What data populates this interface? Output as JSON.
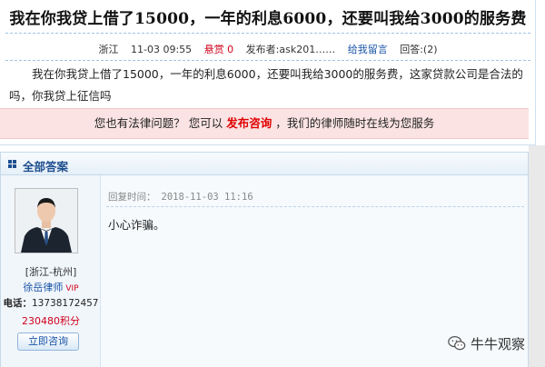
{
  "question": {
    "title": "我在你我贷上借了15000，一年的利息6000，还要叫我给3000的服务费",
    "location": "浙江",
    "time": "11-03 09:55",
    "reward_text": "悬赏 0",
    "publisher": "发布者:ask201……",
    "message_link": "给我留言",
    "answers_count": "回答:(2)",
    "body": "我在你我贷上借了15000，一年的利息6000，还要叫我给3000的服务费，这家贷款公司是合法的吗，你我贷上征信吗"
  },
  "cta": {
    "prefix": "您也有法律问题？ 您可以",
    "link": "发布咨询",
    "suffix": "，我们的律师随时在线为您服务"
  },
  "answers": {
    "section_title": "全部答案",
    "items": [
      {
        "lawyer": {
          "location": "[浙江-杭州]",
          "name": "徐岳律师",
          "vip": "VIP",
          "phone_label": "电话：",
          "phone": "13738172457",
          "points": "230480积分",
          "consult_button": "立即咨询"
        },
        "reply_time_label": "回复时间：",
        "reply_time": "2018-11-03 11:16",
        "reply_body": "小心诈骗。"
      }
    ]
  },
  "watermark": {
    "text": "牛牛观察"
  },
  "colors": {
    "accent_blue": "#1f4f8f",
    "link_red": "#e00000",
    "cta_background": "#fbe3e3"
  },
  "icons": {
    "section": "grid-icon",
    "watermark": "wechat-icon"
  }
}
